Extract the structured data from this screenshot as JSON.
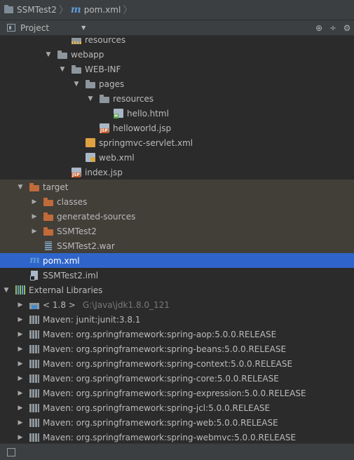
{
  "breadcrumb": {
    "project": "SSMTest2",
    "file": "pom.xml",
    "file_icon": "m"
  },
  "toolbar": {
    "view_label": "Project",
    "dropdown_glyph": "▼",
    "buttons": [
      {
        "name": "locate-icon",
        "glyph": "⊕"
      },
      {
        "name": "collapse-all-icon",
        "glyph": "÷"
      },
      {
        "name": "settings-icon",
        "glyph": "⚙"
      }
    ]
  },
  "tree": [
    {
      "label": "resources",
      "depth": 4,
      "arrow": "",
      "icon": "res",
      "style": "normal"
    },
    {
      "label": "webapp",
      "depth": 3,
      "arrow": "open",
      "icon": "folder",
      "style": "normal"
    },
    {
      "label": "WEB-INF",
      "depth": 4,
      "arrow": "open",
      "icon": "folder",
      "style": "normal"
    },
    {
      "label": "pages",
      "depth": 5,
      "arrow": "open",
      "icon": "folder",
      "style": "normal"
    },
    {
      "label": "resources",
      "depth": 6,
      "arrow": "open",
      "icon": "folder",
      "style": "normal"
    },
    {
      "label": "hello.html",
      "depth": 7,
      "arrow": "",
      "icon": "html",
      "badge": "H",
      "style": "normal"
    },
    {
      "label": "helloworld.jsp",
      "depth": 6,
      "arrow": "",
      "icon": "jsp",
      "badge": "JSP",
      "style": "normal"
    },
    {
      "label": "springmvc-servlet.xml",
      "depth": 5,
      "arrow": "",
      "icon": "xml",
      "style": "normal"
    },
    {
      "label": "web.xml",
      "depth": 5,
      "arrow": "",
      "icon": "webxml",
      "style": "normal"
    },
    {
      "label": "index.jsp",
      "depth": 4,
      "arrow": "",
      "icon": "jsp",
      "badge": "JSP",
      "style": "normal"
    },
    {
      "label": "target",
      "depth": 1,
      "arrow": "open",
      "icon": "folder-ex",
      "style": "excluded"
    },
    {
      "label": "classes",
      "depth": 2,
      "arrow": "closed",
      "icon": "folder-ex",
      "style": "excluded"
    },
    {
      "label": "generated-sources",
      "depth": 2,
      "arrow": "closed",
      "icon": "folder-ex",
      "style": "excluded"
    },
    {
      "label": "SSMTest2",
      "depth": 2,
      "arrow": "closed",
      "icon": "folder-ex",
      "style": "excluded"
    },
    {
      "label": "SSMTest2.war",
      "depth": 2,
      "arrow": "",
      "icon": "war",
      "style": "excluded"
    },
    {
      "label": "pom.xml",
      "depth": 1,
      "arrow": "",
      "icon": "m",
      "style": "selected"
    },
    {
      "label": "SSMTest2.iml",
      "depth": 1,
      "arrow": "",
      "icon": "iml",
      "style": "normal"
    },
    {
      "label": "External Libraries",
      "depth": 0,
      "arrow": "open",
      "icon": "libs",
      "style": "normal"
    },
    {
      "label": "< 1.8 >",
      "path": "G:\\Java\\jdk1.8.0_121",
      "depth": 1,
      "arrow": "closed",
      "icon": "jdk",
      "style": "normal"
    },
    {
      "label": "Maven: junit:junit:3.8.1",
      "depth": 1,
      "arrow": "closed",
      "icon": "lib",
      "style": "normal"
    },
    {
      "label": "Maven: org.springframework:spring-aop:5.0.0.RELEASE",
      "depth": 1,
      "arrow": "closed",
      "icon": "lib",
      "style": "normal"
    },
    {
      "label": "Maven: org.springframework:spring-beans:5.0.0.RELEASE",
      "depth": 1,
      "arrow": "closed",
      "icon": "lib",
      "style": "normal"
    },
    {
      "label": "Maven: org.springframework:spring-context:5.0.0.RELEASE",
      "depth": 1,
      "arrow": "closed",
      "icon": "lib",
      "style": "normal"
    },
    {
      "label": "Maven: org.springframework:spring-core:5.0.0.RELEASE",
      "depth": 1,
      "arrow": "closed",
      "icon": "lib",
      "style": "normal"
    },
    {
      "label": "Maven: org.springframework:spring-expression:5.0.0.RELEASE",
      "depth": 1,
      "arrow": "closed",
      "icon": "lib",
      "style": "normal"
    },
    {
      "label": "Maven: org.springframework:spring-jcl:5.0.0.RELEASE",
      "depth": 1,
      "arrow": "closed",
      "icon": "lib",
      "style": "normal"
    },
    {
      "label": "Maven: org.springframework:spring-web:5.0.0.RELEASE",
      "depth": 1,
      "arrow": "closed",
      "icon": "lib",
      "style": "normal"
    },
    {
      "label": "Maven: org.springframework:spring-webmvc:5.0.0.RELEASE",
      "depth": 1,
      "arrow": "closed",
      "icon": "lib",
      "style": "normal"
    }
  ],
  "colors": {
    "background": "#2b2b2b",
    "panel": "#3c3f41",
    "selection": "#2f65ca",
    "excluded_row": "#423f39",
    "excluded_folder": "#c16a3a",
    "maven_blue": "#5d9ad6"
  }
}
